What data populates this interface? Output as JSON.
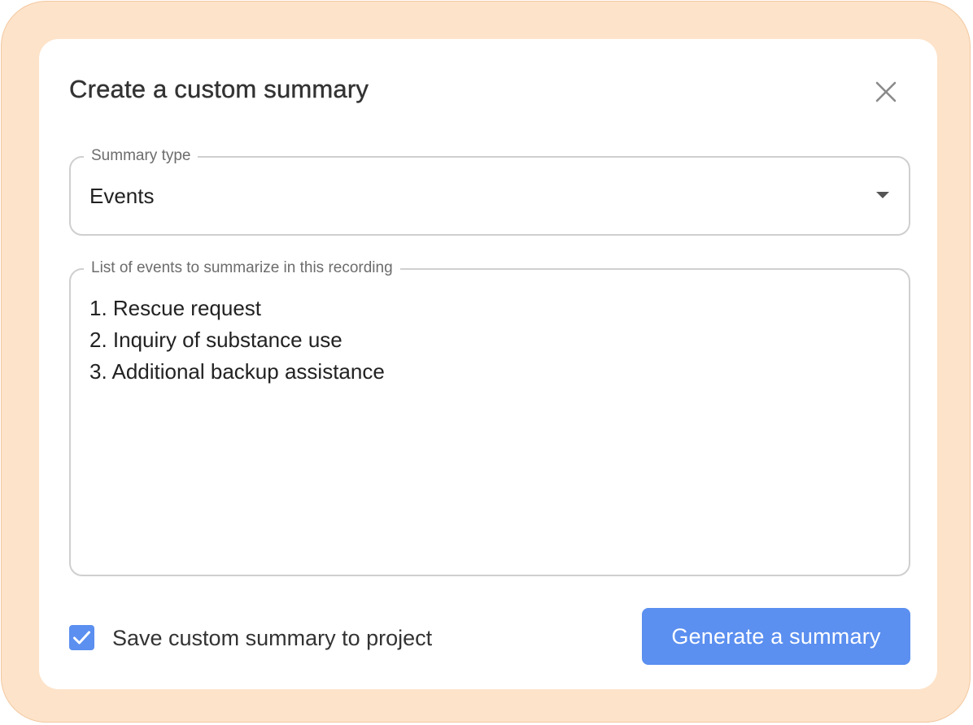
{
  "dialog": {
    "title": "Create a custom summary",
    "close_icon": "close-icon"
  },
  "summary_type": {
    "label": "Summary type",
    "value": "Events",
    "dropdown_icon": "chevron-down-icon"
  },
  "events": {
    "label": "List of events to summarize in this recording",
    "items": [
      "1. Rescue request",
      "2. Inquiry of substance use",
      "3. Additional backup assistance"
    ]
  },
  "save_option": {
    "label": "Save custom summary to project",
    "checked": true
  },
  "generate_button": {
    "label": "Generate a summary"
  },
  "colors": {
    "backdrop": "#fde3c9",
    "accent": "#5b8ff0",
    "dialog_background": "#ffffff"
  }
}
